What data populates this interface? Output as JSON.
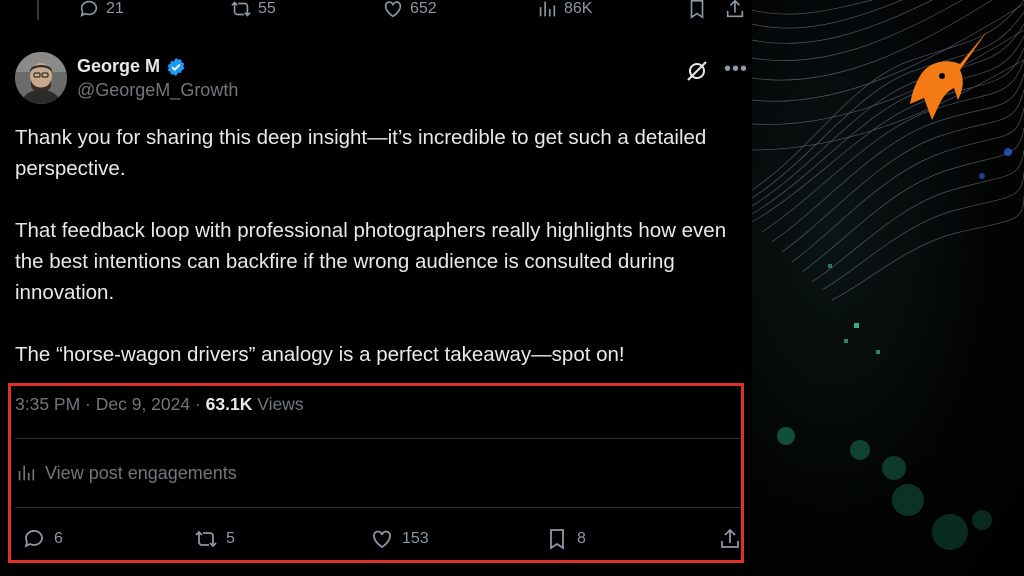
{
  "prev_tweet_actions": {
    "replies": "21",
    "reposts": "55",
    "likes": "652",
    "views": "86K"
  },
  "tweet": {
    "author_name": "George M",
    "author_handle": "@GeorgeM_Growth",
    "verified": true,
    "paragraphs": [
      "Thank you for sharing this deep insight—it’s incredible to get such a detailed perspective.",
      "That feedback loop with professional photographers really highlights how even the best intentions can backfire if the wrong audience is consulted during innovation.",
      "The “horse-wagon drivers” analogy is a perfect takeaway—spot on!"
    ],
    "timestamp": "3:35 PM · Dec 9, 2024 · ",
    "views_count": "63.1K",
    "views_label": " Views",
    "engagements_label": "View post engagements",
    "actions": {
      "replies": "6",
      "reposts": "5",
      "likes": "153",
      "bookmarks": "8"
    }
  },
  "colors": {
    "highlight_border": "#e0302a",
    "verified_badge": "#1d9bf0",
    "logo_orange": "#f47a16"
  }
}
